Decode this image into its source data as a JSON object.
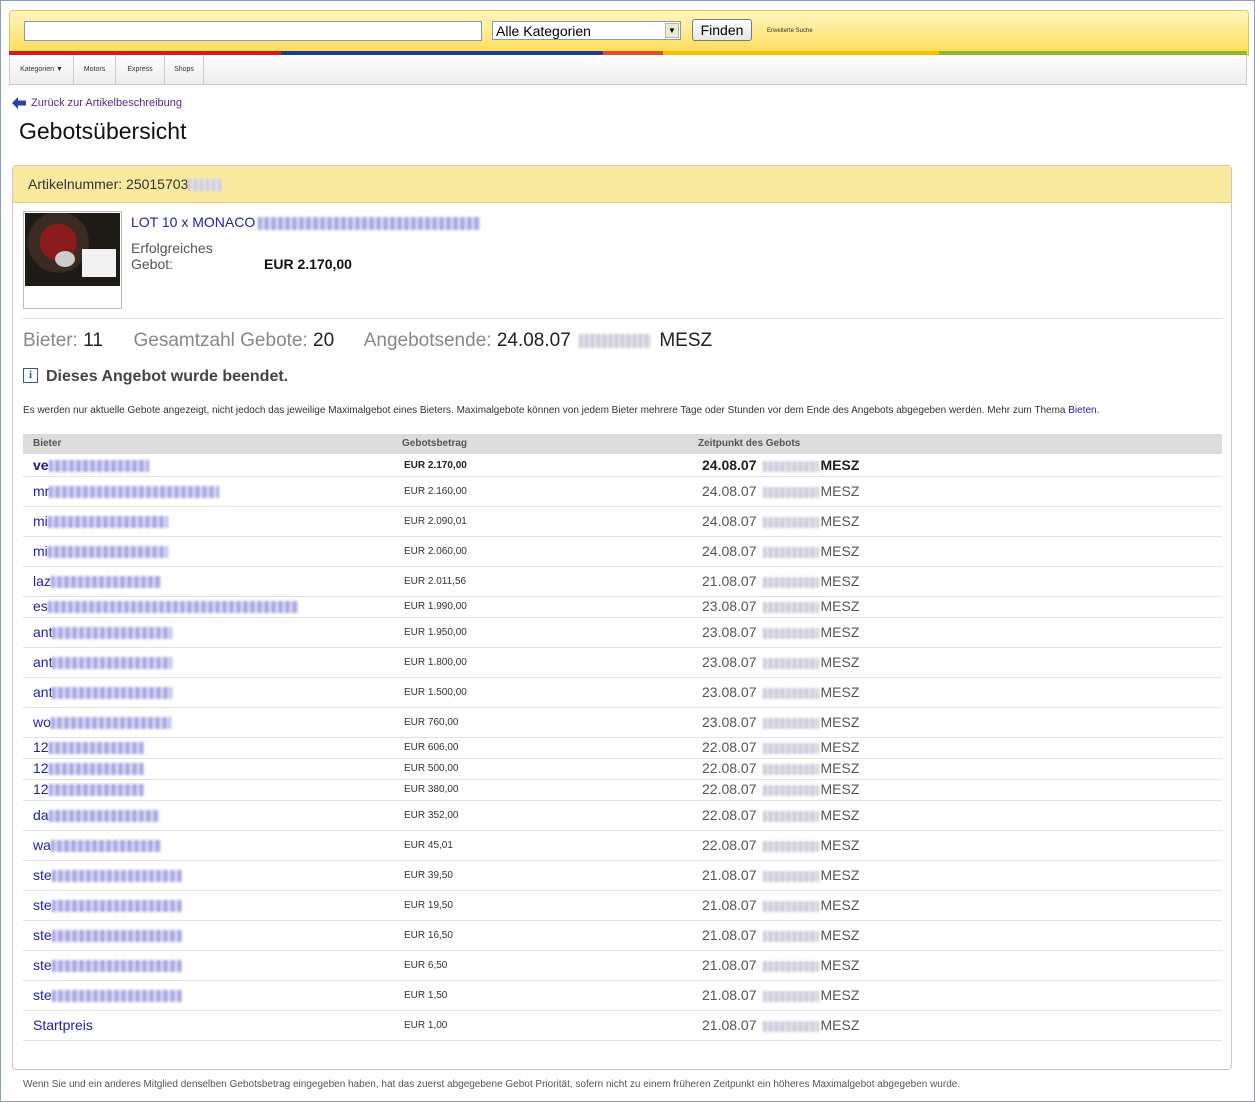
{
  "header": {
    "search_value": "",
    "category_selected": "Alle Kategorien",
    "find_label": "Finden",
    "advanced_label": "Erweiterte Suche",
    "colorbar": [
      "#d61b1b",
      "#1e3a96",
      "#e05020",
      "#f5c200",
      "#8fb82b"
    ]
  },
  "nav": [
    "Kategorien",
    "Motors",
    "Express",
    "Shops"
  ],
  "back_link": "Zurück zur Artikelbeschreibung",
  "page_title": "Gebotsübersicht",
  "item": {
    "number_label": "Artikelnummer:",
    "number_value": "25015703",
    "title": "LOT 10 x MONACO",
    "win_label": "Erfolgreiches Gebot:",
    "win_value": "EUR 2.170,00"
  },
  "stats": {
    "bidders_label": "Bieter:",
    "bidders_value": "11",
    "bids_label": "Gesamtzahl Gebote:",
    "bids_value": "20",
    "end_label": "Angebotsende:",
    "end_date": "24.08.07",
    "end_suffix": "MESZ"
  },
  "ended_message": "Dieses Angebot wurde beendet.",
  "note": "Es werden nur aktuelle Gebote angezeigt, nicht jedoch das jeweilige Maximalgebot eines Bieters. Maximalgebote können von jedem Bieter mehrere Tage oder Stunden vor dem Ende des Angebots abgegeben werden. Mehr zum Thema",
  "note_link": "Bieten",
  "table": {
    "headers": [
      "Bieter",
      "Gebotsbetrag",
      "Zeitpunkt des Gebots"
    ],
    "rows": [
      {
        "bidder": "ve",
        "amount": "EUR 2.170,00",
        "date": "24.08.07",
        "tz": "MESZ"
      },
      {
        "bidder": "mr",
        "amount": "EUR 2.160,00",
        "date": "24.08.07",
        "tz": "MESZ"
      },
      {
        "bidder": "mi",
        "amount": "EUR 2.090,01",
        "date": "24.08.07",
        "tz": "MESZ"
      },
      {
        "bidder": "mi",
        "amount": "EUR 2.060,00",
        "date": "24.08.07",
        "tz": "MESZ"
      },
      {
        "bidder": "laz",
        "amount": "EUR 2.011,56",
        "date": "21.08.07",
        "tz": "MESZ"
      },
      {
        "bidder": "es",
        "amount": "EUR 1.990,00",
        "date": "23.08.07",
        "tz": "MESZ"
      },
      {
        "bidder": "ant",
        "amount": "EUR 1.950,00",
        "date": "23.08.07",
        "tz": "MESZ"
      },
      {
        "bidder": "ant",
        "amount": "EUR 1.800,00",
        "date": "23.08.07",
        "tz": "MESZ"
      },
      {
        "bidder": "ant",
        "amount": "EUR 1.500,00",
        "date": "23.08.07",
        "tz": "MESZ"
      },
      {
        "bidder": "wo",
        "amount": "EUR 760,00",
        "date": "23.08.07",
        "tz": "MESZ"
      },
      {
        "bidder": "12",
        "amount": "EUR 606,00",
        "date": "22.08.07",
        "tz": "MESZ"
      },
      {
        "bidder": "12",
        "amount": "EUR 500,00",
        "date": "22.08.07",
        "tz": "MESZ"
      },
      {
        "bidder": "12",
        "amount": "EUR 380,00",
        "date": "22.08.07",
        "tz": "MESZ"
      },
      {
        "bidder": "da",
        "amount": "EUR 352,00",
        "date": "22.08.07",
        "tz": "MESZ"
      },
      {
        "bidder": "wa",
        "amount": "EUR 45,01",
        "date": "22.08.07",
        "tz": "MESZ"
      },
      {
        "bidder": "ste",
        "amount": "EUR 39,50",
        "date": "21.08.07",
        "tz": "MESZ"
      },
      {
        "bidder": "ste",
        "amount": "EUR 19,50",
        "date": "21.08.07",
        "tz": "MESZ"
      },
      {
        "bidder": "ste",
        "amount": "EUR 16,50",
        "date": "21.08.07",
        "tz": "MESZ"
      },
      {
        "bidder": "ste",
        "amount": "EUR 6,50",
        "date": "21.08.07",
        "tz": "MESZ"
      },
      {
        "bidder": "ste",
        "amount": "EUR 1,50",
        "date": "21.08.07",
        "tz": "MESZ"
      },
      {
        "bidder": "Startpreis",
        "amount": "EUR 1,00",
        "date": "21.08.07",
        "tz": "MESZ"
      }
    ]
  },
  "footer_note": "Wenn Sie und ein anderes Mitglied denselben Gebotsbetrag eingegeben haben, hat das zuerst abgegebene Gebot Priorität, sofern nicht zu einem früheren Zeitpunkt ein höheres Maximalgebot abgegeben wurde."
}
